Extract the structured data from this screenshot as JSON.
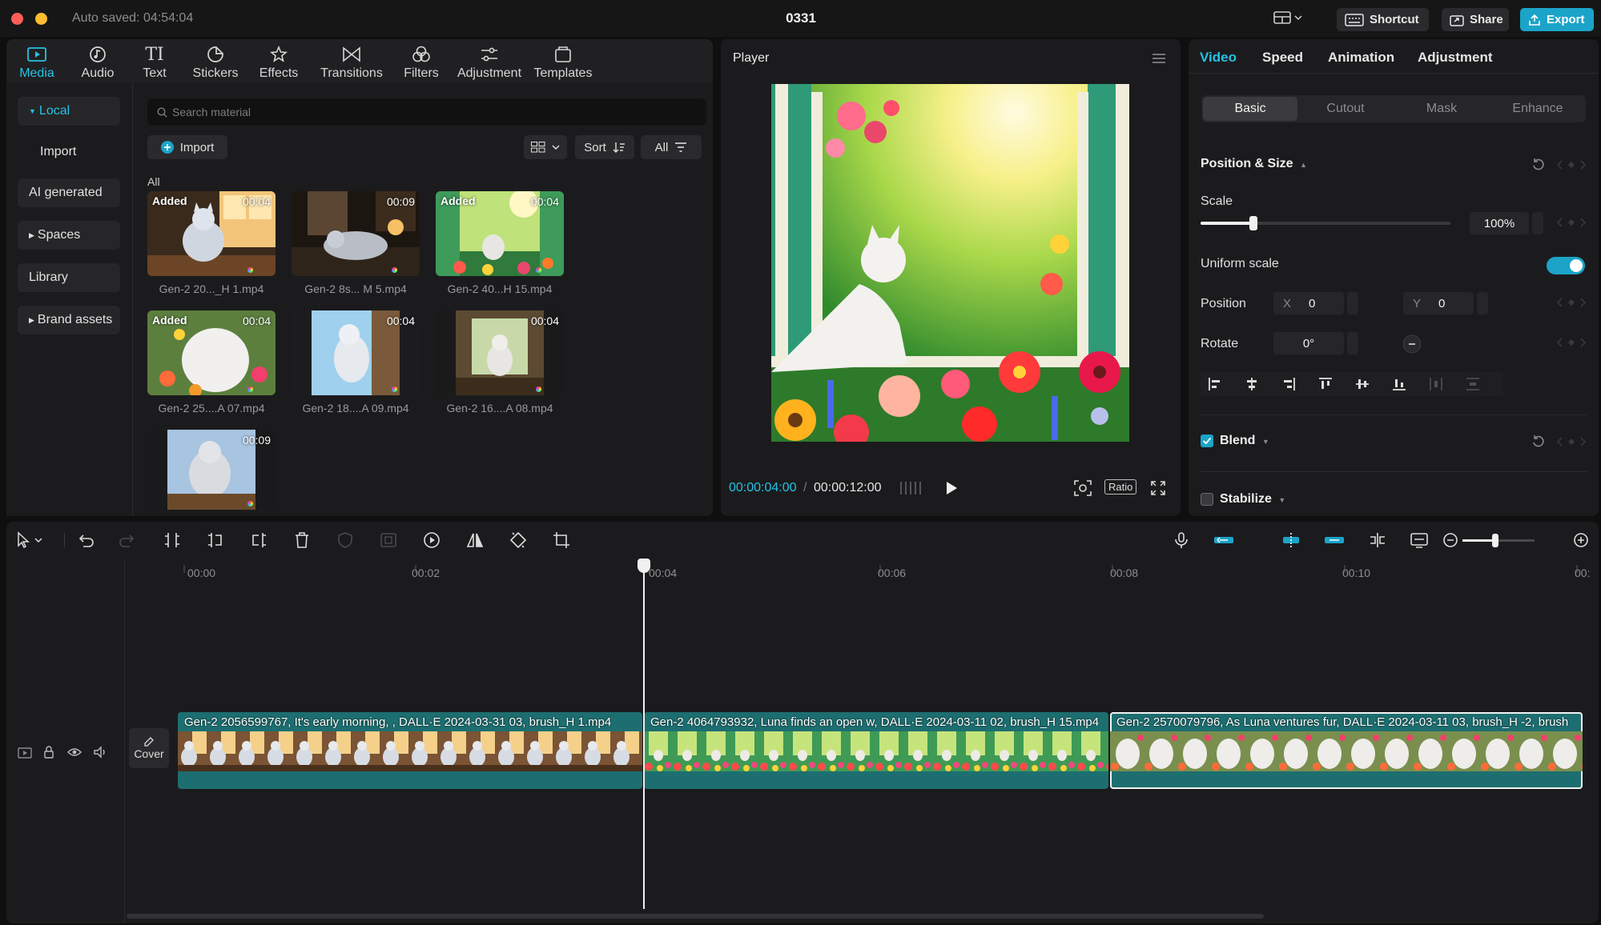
{
  "titlebar": {
    "autosave": "Auto saved: 04:54:04",
    "project_title": "0331",
    "shortcut_label": "Shortcut",
    "share_label": "Share",
    "export_label": "Export"
  },
  "toolbar": {
    "tabs": [
      {
        "label": "Media",
        "icon": "media-icon"
      },
      {
        "label": "Audio",
        "icon": "audio-icon"
      },
      {
        "label": "Text",
        "icon": "text-icon"
      },
      {
        "label": "Stickers",
        "icon": "stickers-icon"
      },
      {
        "label": "Effects",
        "icon": "effects-icon"
      },
      {
        "label": "Transitions",
        "icon": "transitions-icon"
      },
      {
        "label": "Filters",
        "icon": "filters-icon"
      },
      {
        "label": "Adjustment",
        "icon": "adjustment-icon"
      },
      {
        "label": "Templates",
        "icon": "templates-icon"
      }
    ],
    "active_tab": "Media"
  },
  "sidebar": {
    "items": [
      {
        "label": "Local",
        "expandable": true,
        "active": true
      },
      {
        "label": "Import"
      },
      {
        "label": "AI generated"
      },
      {
        "label": "Spaces",
        "expandable": true
      },
      {
        "label": "Library"
      },
      {
        "label": "Brand assets",
        "expandable": true
      }
    ]
  },
  "media": {
    "search_placeholder": "Search material",
    "import_label": "Import",
    "sort_label": "Sort",
    "filter_label": "All",
    "section_label": "All",
    "items": [
      {
        "name": "Gen-2 20..._H 1.mp4",
        "duration": "00:04",
        "added": "Added"
      },
      {
        "name": "Gen-2 8s... M 5.mp4",
        "duration": "00:09",
        "added": ""
      },
      {
        "name": "Gen-2 40...H 15.mp4",
        "duration": "00:04",
        "added": "Added"
      },
      {
        "name": "Gen-2 25....A 07.mp4",
        "duration": "00:04",
        "added": "Added"
      },
      {
        "name": "Gen-2 18....A 09.mp4",
        "duration": "00:04",
        "added": ""
      },
      {
        "name": "Gen-2 16....A 08.mp4",
        "duration": "00:04",
        "added": ""
      },
      {
        "name": "",
        "duration": "00:09",
        "added": ""
      }
    ]
  },
  "player": {
    "title": "Player",
    "current_time": "00:00:04:00",
    "total_time": "00:00:12:00",
    "ratio_label": "Ratio"
  },
  "properties": {
    "tabs": [
      "Video",
      "Speed",
      "Animation",
      "Adjustment"
    ],
    "active_tab": "Video",
    "subtabs": [
      "Basic",
      "Cutout",
      "Mask",
      "Enhance"
    ],
    "active_subtab": "Basic",
    "position_size_title": "Position & Size",
    "scale_label": "Scale",
    "scale_value": "100%",
    "scale_fraction": 0.21,
    "uniform_scale_label": "Uniform scale",
    "uniform_scale_on": true,
    "position_label": "Position",
    "pos_x_prefix": "X",
    "pos_x_value": "0",
    "pos_y_prefix": "Y",
    "pos_y_value": "0",
    "rotate_label": "Rotate",
    "rotate_value": "0°",
    "blend_label": "Blend",
    "blend_checked": true,
    "stabilize_label": "Stabilize",
    "stabilize_checked": false
  },
  "timeline": {
    "ruler_labels": [
      "00:00",
      "00:02",
      "00:04",
      "00:06",
      "00:08",
      "00:10",
      "00:"
    ],
    "cover_label": "Cover",
    "zoom_fraction": 0.45,
    "clips": [
      {
        "label": "Gen-2 2056599767, It's early morning, , DALL·E 2024-03-31 03, brush_H 1.mp4",
        "selected": false
      },
      {
        "label": "Gen-2 4064793932, Luna finds an open w, DALL·E 2024-03-11 02, brush_H 15.mp4",
        "selected": false
      },
      {
        "label": "Gen-2 2570079796, As Luna ventures fur, DALL·E 2024-03-11 03, brush_H -2, brush",
        "selected": true
      }
    ]
  },
  "colors": {
    "accent": "#25c2e6",
    "export": "#1ba4c8",
    "clip_base": "#1d6e70",
    "panel_bg": "#1b1b1d",
    "app_bg": "#0f0f10"
  }
}
